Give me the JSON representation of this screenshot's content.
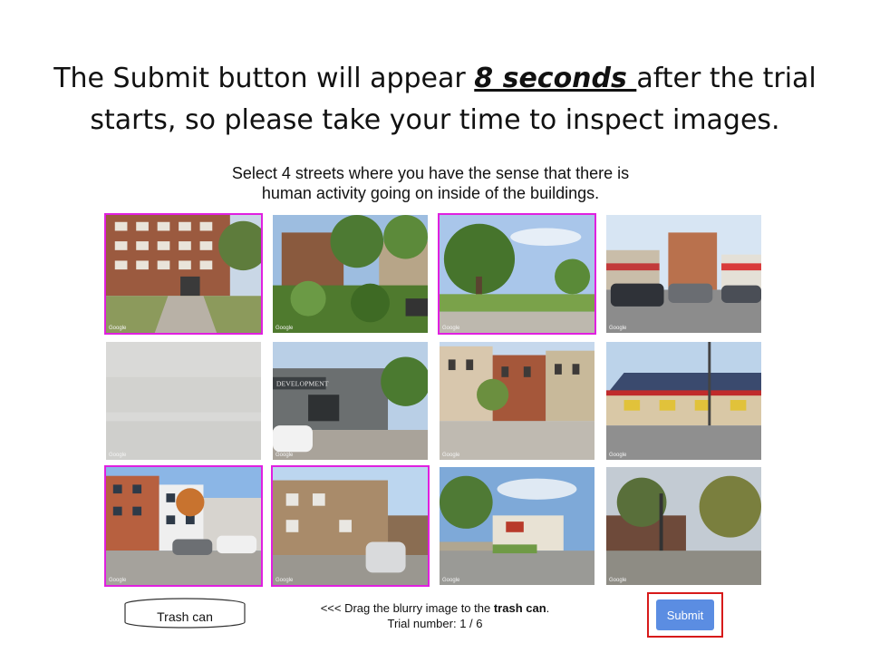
{
  "headline": {
    "part1": "The Submit button will appear ",
    "emphasis": "8 seconds ",
    "part2": "after the trial",
    "line2": "starts, so please take your time to inspect images."
  },
  "instruction": {
    "line1": "Select 4 streets where you have the sense that there is",
    "line2": "human activity going on inside of the buildings."
  },
  "images": [
    {
      "name": "street-image-1",
      "selected": true,
      "scene": "apartment-block",
      "watermark": "Google"
    },
    {
      "name": "street-image-2",
      "selected": false,
      "scene": "house-garden",
      "watermark": "Google"
    },
    {
      "name": "street-image-3",
      "selected": true,
      "scene": "tree-lawn",
      "watermark": "Google"
    },
    {
      "name": "street-image-4",
      "selected": false,
      "scene": "shops-cars",
      "watermark": "Google"
    },
    {
      "name": "street-image-5",
      "selected": false,
      "scene": "blurry",
      "watermark": "Google"
    },
    {
      "name": "street-image-6",
      "selected": false,
      "scene": "development-building",
      "watermark": "Google"
    },
    {
      "name": "street-image-7",
      "selected": false,
      "scene": "brownstones",
      "watermark": "Google"
    },
    {
      "name": "street-image-8",
      "selected": false,
      "scene": "solar-roof-store",
      "watermark": "Google"
    },
    {
      "name": "street-image-9",
      "selected": true,
      "scene": "modern-apartments",
      "watermark": "Google"
    },
    {
      "name": "street-image-10",
      "selected": true,
      "scene": "brick-alley",
      "watermark": "Google"
    },
    {
      "name": "street-image-11",
      "selected": false,
      "scene": "corner-store",
      "watermark": "Google"
    },
    {
      "name": "street-image-12",
      "selected": false,
      "scene": "vacant-lot",
      "watermark": "Google"
    }
  ],
  "trash": {
    "label": "Trash can"
  },
  "drag_hint": {
    "prefix": "<<< Drag the blurry image to the ",
    "bold": "trash can",
    "suffix": "."
  },
  "trial": {
    "text": "Trial number: 1 / 6"
  },
  "submit": {
    "label": "Submit"
  },
  "colors": {
    "selected_border": "#e020e0",
    "submit_bg": "#5b8de2",
    "submit_frame": "#d71a1a"
  }
}
